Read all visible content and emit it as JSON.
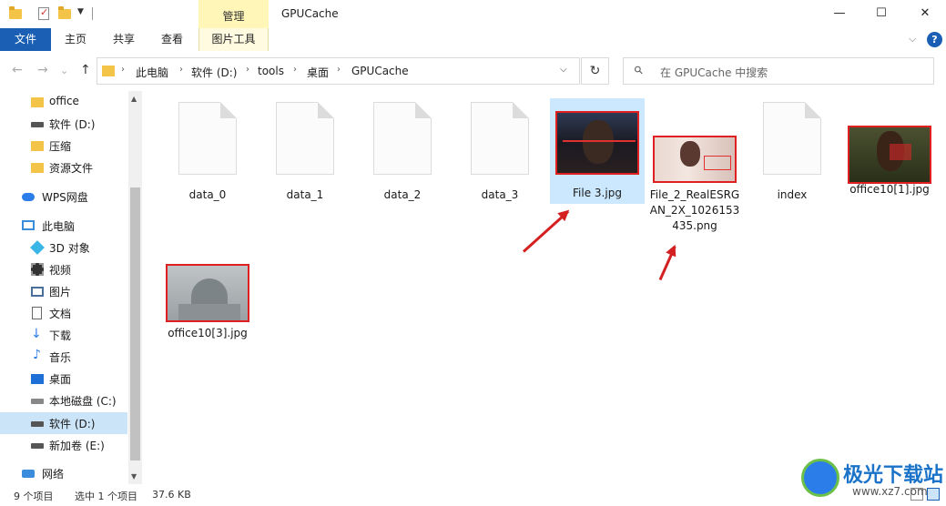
{
  "window": {
    "title": "GPUCache",
    "context_group_label": "管理",
    "minimize": "—",
    "maximize": "☐",
    "close": "✕"
  },
  "ribbon": {
    "tabs": [
      "文件",
      "主页",
      "共享",
      "查看",
      "图片工具"
    ],
    "help": "?",
    "expand": "⌵"
  },
  "nav": {
    "back": "←",
    "forward": "→",
    "recent": "⌄",
    "up": "↑",
    "breadcrumb": [
      "此电脑",
      "软件 (D:)",
      "tools",
      "桌面",
      "GPUCache"
    ],
    "dropdown": "⌵",
    "refresh": "↻",
    "search_placeholder": "在 GPUCache 中搜索"
  },
  "sidebar": {
    "items": [
      {
        "label": "office",
        "icon": "folder-icon"
      },
      {
        "label": "软件 (D:)",
        "icon": "drive-icon"
      },
      {
        "label": "压缩",
        "icon": "folder-icon"
      },
      {
        "label": "资源文件",
        "icon": "folder-icon"
      },
      {
        "label": "WPS网盘",
        "icon": "cloud-icon"
      },
      {
        "label": "此电脑",
        "icon": "pc-icon"
      },
      {
        "label": "3D 对象",
        "icon": "cube-icon"
      },
      {
        "label": "视频",
        "icon": "video-icon"
      },
      {
        "label": "图片",
        "icon": "picture-icon"
      },
      {
        "label": "文档",
        "icon": "document-icon"
      },
      {
        "label": "下载",
        "icon": "download-icon"
      },
      {
        "label": "音乐",
        "icon": "music-icon"
      },
      {
        "label": "桌面",
        "icon": "desktop-icon"
      },
      {
        "label": "本地磁盘 (C:)",
        "icon": "drive-icon"
      },
      {
        "label": "软件 (D:)",
        "icon": "drive-icon",
        "selected": true
      },
      {
        "label": "新加卷 (E:)",
        "icon": "drive-icon"
      },
      {
        "label": "网络",
        "icon": "network-icon"
      }
    ],
    "down_glyph": "↓",
    "music_glyph": "♪"
  },
  "files": [
    {
      "name": "data_0",
      "type": "generic"
    },
    {
      "name": "data_1",
      "type": "generic"
    },
    {
      "name": "data_2",
      "type": "generic"
    },
    {
      "name": "data_3",
      "type": "generic"
    },
    {
      "name": "File 3.jpg",
      "type": "image",
      "selected": true
    },
    {
      "name": "File_2_RealESRGAN_2X_1026153435.png",
      "type": "image"
    },
    {
      "name": "index",
      "type": "generic"
    },
    {
      "name": "office10[1].jpg",
      "type": "image"
    },
    {
      "name": "office10[3].jpg",
      "type": "image"
    }
  ],
  "status": {
    "item_count": "9 个项目",
    "selection": "选中 1 个项目",
    "size": "37.6 KB"
  },
  "watermark": {
    "brand": "极光下载站",
    "url": "www.xz7.com"
  },
  "colors": {
    "accent": "#1a5fb4",
    "selection": "#cce8ff",
    "annotation_arrow": "#d42020",
    "folder": "#f3c448"
  }
}
